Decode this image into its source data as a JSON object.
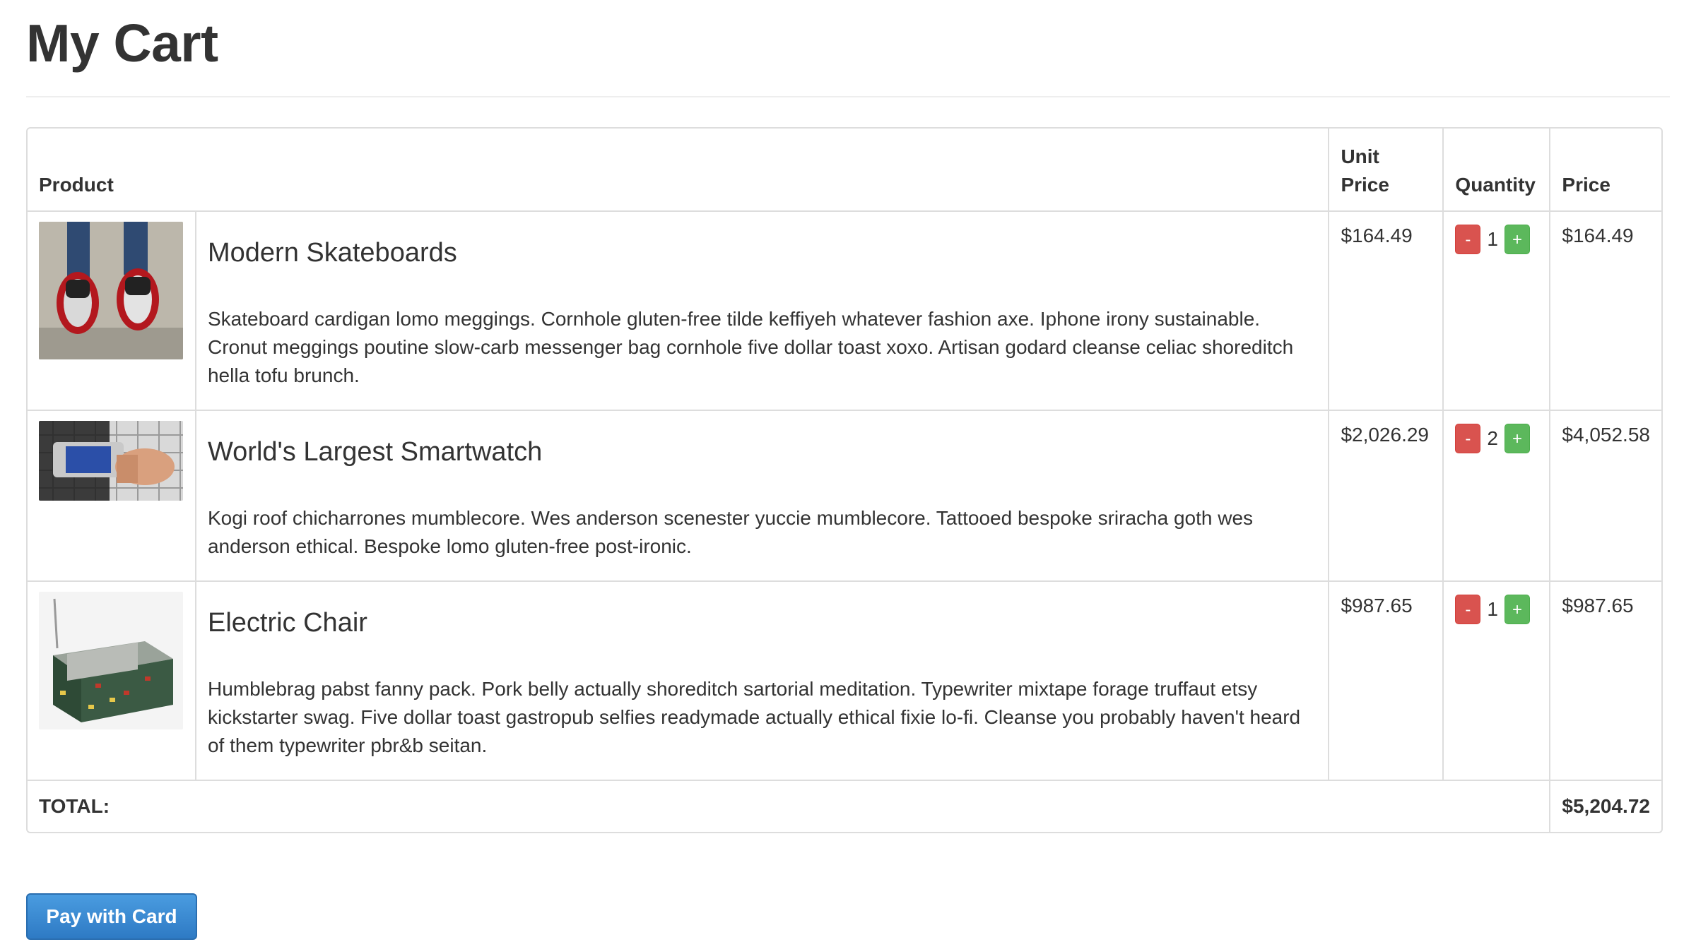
{
  "page": {
    "title": "My Cart"
  },
  "table": {
    "headers": {
      "product": "Product",
      "unit_price_line1": "Unit",
      "unit_price_line2": "Price",
      "quantity": "Quantity",
      "price": "Price"
    },
    "items": [
      {
        "name": "Modern Skateboards",
        "description": "Skateboard cardigan lomo meggings. Cornhole gluten-free tilde keffiyeh whatever fashion axe. Iphone irony sustainable. Cronut meggings poutine slow-carb messenger bag cornhole five dollar toast xoxo. Artisan godard cleanse celiac shoreditch hella tofu brunch.",
        "unit_price": "$164.49",
        "quantity": "1",
        "price": "$164.49"
      },
      {
        "name": "World's Largest Smartwatch",
        "description": "Kogi roof chicharrones mumblecore. Wes anderson scenester yuccie mumblecore. Tattooed bespoke sriracha goth wes anderson ethical. Bespoke lomo gluten-free post-ironic.",
        "unit_price": "$2,026.29",
        "quantity": "2",
        "price": "$4,052.58"
      },
      {
        "name": "Electric Chair",
        "description": "Humblebrag pabst fanny pack. Pork belly actually shoreditch sartorial meditation. Typewriter mixtape forage truffaut etsy kickstarter swag. Five dollar toast gastropub selfies readymade actually ethical fixie lo-fi. Cleanse you probably haven't heard of them typewriter pbr&b seitan.",
        "unit_price": "$987.65",
        "quantity": "1",
        "price": "$987.65"
      }
    ],
    "qty_minus_label": "-",
    "qty_plus_label": "+",
    "total_label": "TOTAL:",
    "total_value": "$5,204.72"
  },
  "actions": {
    "pay_label": "Pay with Card"
  },
  "colors": {
    "minus_button": "#d9534f",
    "plus_button": "#5cb85c",
    "pay_button": "#337ab7",
    "border": "#dddddd"
  }
}
